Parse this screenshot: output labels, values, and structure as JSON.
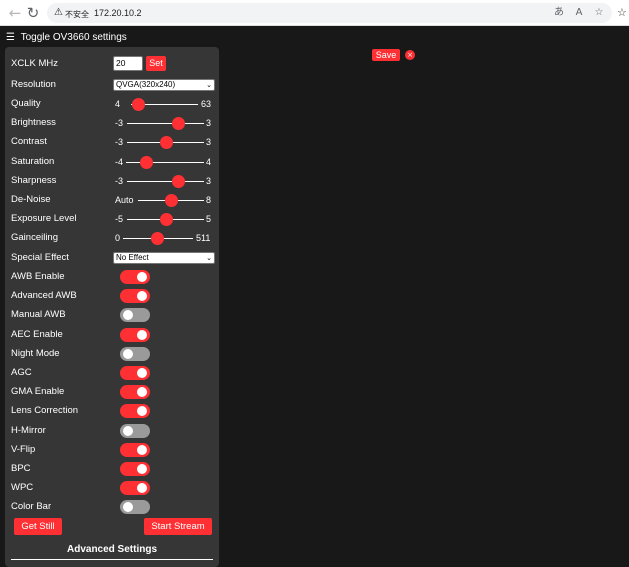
{
  "browser": {
    "security_label": "不安全",
    "url": "172.20.10.2"
  },
  "header": {
    "title": "Toggle OV3660 settings"
  },
  "xclk": {
    "label": "XCLK MHz",
    "value": "20",
    "set_label": "Set"
  },
  "resolution": {
    "label": "Resolution",
    "selected": "QVGA(320x240)"
  },
  "sliders": [
    {
      "id": "quality",
      "label": "Quality",
      "min_label": "4",
      "max_label": "63",
      "min": 4,
      "max": 63,
      "value": 10
    },
    {
      "id": "brightness",
      "label": "Brightness",
      "min_label": "-3",
      "max_label": "3",
      "min": -3,
      "max": 3,
      "value": 1
    },
    {
      "id": "contrast",
      "label": "Contrast",
      "min_label": "-3",
      "max_label": "3",
      "min": -3,
      "max": 3,
      "value": 0
    },
    {
      "id": "saturation",
      "label": "Saturation",
      "min_label": "-4",
      "max_label": "4",
      "min": -4,
      "max": 4,
      "value": -2
    },
    {
      "id": "sharpness",
      "label": "Sharpness",
      "min_label": "-3",
      "max_label": "3",
      "min": -3,
      "max": 3,
      "value": 1
    },
    {
      "id": "denoise",
      "label": "De-Noise",
      "min_label": "Auto",
      "max_label": "8",
      "min": 0,
      "max": 8,
      "value": 4
    },
    {
      "id": "exposure",
      "label": "Exposure Level",
      "min_label": "-5",
      "max_label": "5",
      "min": -5,
      "max": 5,
      "value": 0
    },
    {
      "id": "gainceiling",
      "label": "Gainceiling",
      "min_label": "0",
      "max_label": "511",
      "min": 0,
      "max": 511,
      "value": 248
    }
  ],
  "special_effect": {
    "label": "Special Effect",
    "selected": "No Effect"
  },
  "toggles": [
    {
      "id": "awb",
      "label": "AWB Enable",
      "on": true
    },
    {
      "id": "adv-awb",
      "label": "Advanced AWB",
      "on": true
    },
    {
      "id": "manual-awb",
      "label": "Manual AWB",
      "on": false
    },
    {
      "id": "aec",
      "label": "AEC Enable",
      "on": true
    },
    {
      "id": "night-mode",
      "label": "Night Mode",
      "on": false
    },
    {
      "id": "agc",
      "label": "AGC",
      "on": true
    },
    {
      "id": "gma",
      "label": "GMA Enable",
      "on": true
    },
    {
      "id": "lens-correction",
      "label": "Lens Correction",
      "on": true
    },
    {
      "id": "h-mirror",
      "label": "H-Mirror",
      "on": false
    },
    {
      "id": "v-flip",
      "label": "V-Flip",
      "on": true
    },
    {
      "id": "bpc",
      "label": "BPC",
      "on": true
    },
    {
      "id": "wpc",
      "label": "WPC",
      "on": true
    },
    {
      "id": "color-bar",
      "label": "Color Bar",
      "on": false
    }
  ],
  "buttons": {
    "get_still": "Get Still",
    "start_stream": "Start Stream"
  },
  "advanced": {
    "title": "Advanced Settings"
  },
  "save": {
    "label": "Save",
    "close": "×"
  },
  "colors": {
    "accent": "#ff3034",
    "panel": "#363636",
    "background": "#181818",
    "toggle_off": "#9a9a9a"
  }
}
